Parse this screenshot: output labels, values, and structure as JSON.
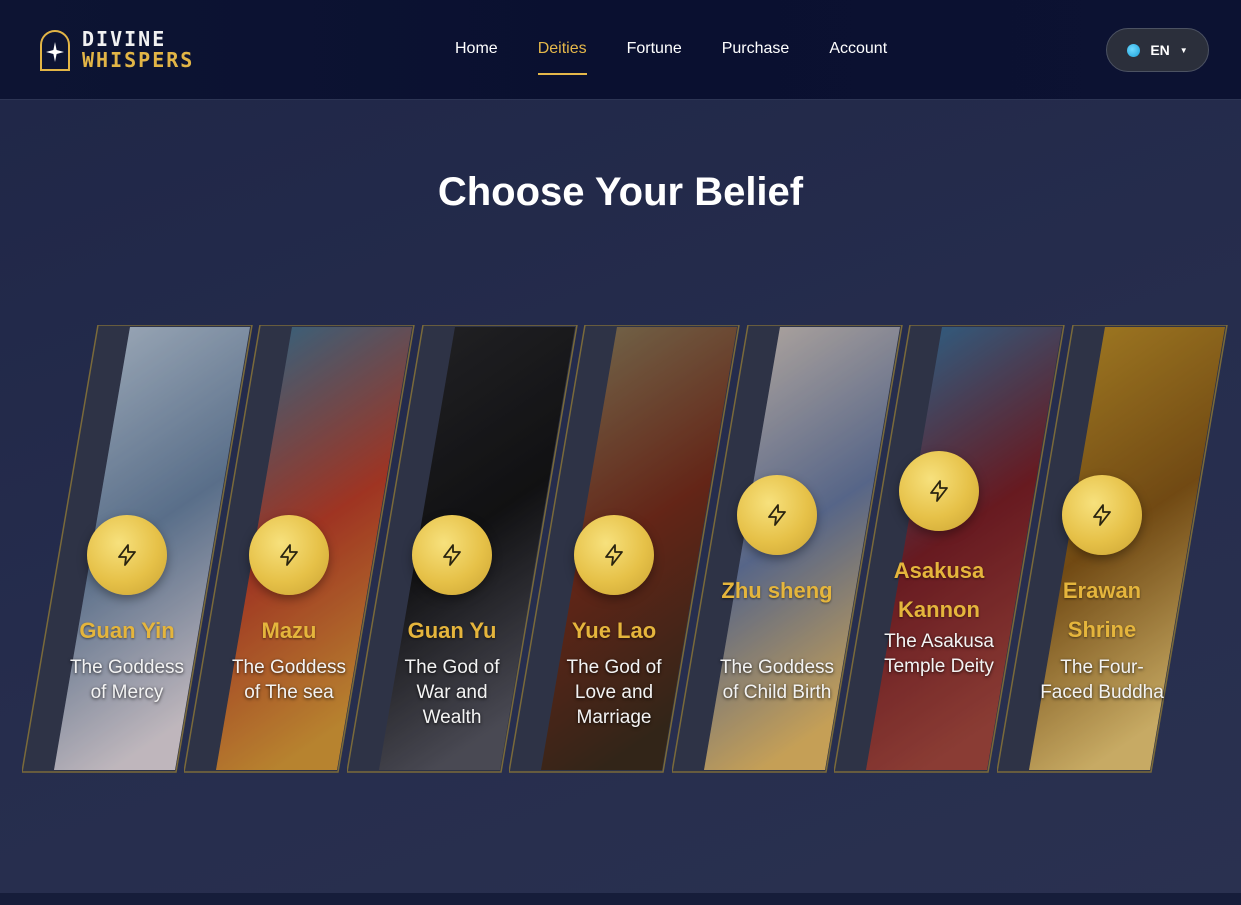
{
  "brand": {
    "line1": "DIVINE",
    "line2": "WHISPERS"
  },
  "nav": {
    "items": [
      "Home",
      "Deities",
      "Fortune",
      "Purchase",
      "Account"
    ],
    "active": "Deities"
  },
  "language": {
    "label": "EN"
  },
  "page_title": "Choose Your Belief",
  "colors": {
    "accent": "#e5b84a",
    "badge": "#e6c148",
    "background": "#232a4a",
    "header": "#0b1131"
  },
  "deities": [
    {
      "name": "Guan Yin",
      "desc": "The Goddess of Mercy",
      "icon": "lightning-icon"
    },
    {
      "name": "Mazu",
      "desc": "The Goddess of The sea",
      "icon": "lightning-icon"
    },
    {
      "name": "Guan Yu",
      "desc": "The God of War and Wealth",
      "icon": "lightning-icon"
    },
    {
      "name": "Yue Lao",
      "desc": "The God of Love and Marriage",
      "icon": "lightning-icon"
    },
    {
      "name": "Zhu sheng",
      "desc": "The Goddess of Child Birth",
      "icon": "lightning-icon"
    },
    {
      "name": "Asakusa Kannon",
      "desc": "The Asakusa Temple Deity",
      "icon": "lightning-icon"
    },
    {
      "name": "Erawan Shrine",
      "desc": "The Four-Faced Buddha",
      "icon": "lightning-icon"
    }
  ]
}
